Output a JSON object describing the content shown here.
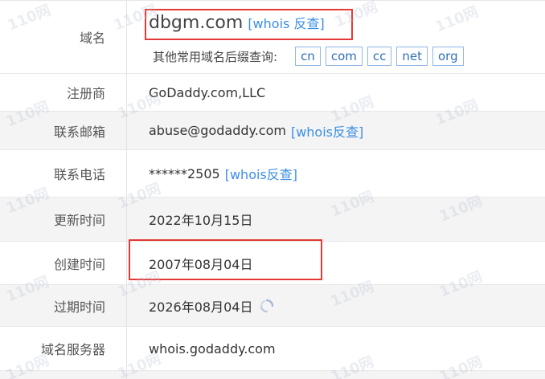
{
  "rows": [
    {
      "label": "域名"
    },
    {
      "label": "注册商",
      "value": "GoDaddy.com,LLC"
    },
    {
      "label": "联系邮箱",
      "value": "abuse@godaddy.com",
      "link": "[whois反查]"
    },
    {
      "label": "联系电话",
      "value": "******2505",
      "link": "[whois反查]"
    },
    {
      "label": "更新时间",
      "value": "2022年10月15日"
    },
    {
      "label": "创建时间",
      "value": "2007年08月04日"
    },
    {
      "label": "过期时间",
      "value": "2026年08月04日"
    },
    {
      "label": "域名服务器",
      "value": "whois.godaddy.com"
    }
  ],
  "domain": {
    "name": "dbgm.com",
    "whois_link": "[whois 反查]",
    "suffix_prompt": "其他常用域名后缀查询:",
    "suffixes": [
      "cn",
      "com",
      "cc",
      "net",
      "org"
    ]
  },
  "watermark": "110网",
  "icons": {
    "expiry": "refresh-icon"
  },
  "colors": {
    "link": "#3a8ee6",
    "highlight_box": "#e53935"
  }
}
